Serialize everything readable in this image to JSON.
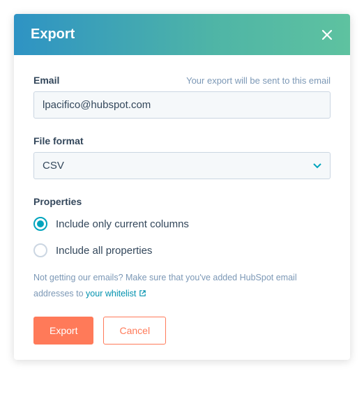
{
  "header": {
    "title": "Export"
  },
  "email": {
    "label": "Email",
    "helper": "Your export will be sent to this email",
    "value": "lpacifico@hubspot.com"
  },
  "fileFormat": {
    "label": "File format",
    "selected": "CSV"
  },
  "properties": {
    "label": "Properties",
    "options": [
      {
        "label": "Include only current columns",
        "selected": true
      },
      {
        "label": "Include all properties",
        "selected": false
      }
    ]
  },
  "hint": {
    "prefix": "Not getting our emails? Make sure that you've added HubSpot email addresses to ",
    "linkText": "your whitelist"
  },
  "buttons": {
    "export": "Export",
    "cancel": "Cancel"
  }
}
